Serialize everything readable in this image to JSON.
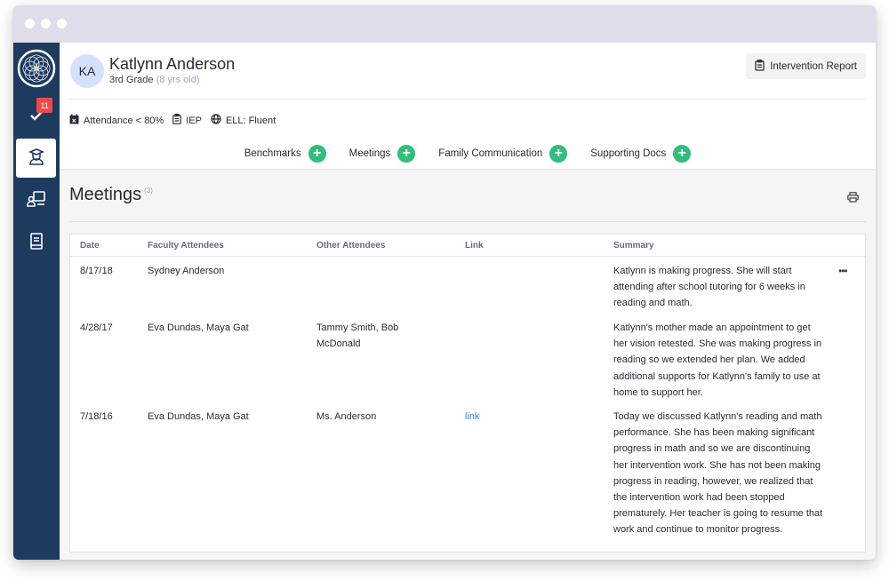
{
  "window": {
    "dots": 3
  },
  "sidebar": {
    "logo": "mandala-logo-icon",
    "items": [
      {
        "name": "tasks",
        "icon": "checkmark-icon",
        "badge": "11"
      },
      {
        "name": "students",
        "icon": "graduate-icon",
        "active": true
      },
      {
        "name": "teaching",
        "icon": "presenter-board-icon"
      },
      {
        "name": "resources",
        "icon": "book-icon"
      }
    ]
  },
  "student": {
    "initials": "KA",
    "name": "Katlynn Anderson",
    "grade": "3rd Grade",
    "age": "(8 yrs old)",
    "tags": [
      {
        "icon": "calendar-x-icon",
        "label": "Attendance < 80%"
      },
      {
        "icon": "clipboard-icon",
        "label": "IEP"
      },
      {
        "icon": "globe-icon",
        "label": "ELL: Fluent"
      }
    ]
  },
  "header": {
    "report_button": "Intervention Report"
  },
  "tabs": [
    {
      "label": "Benchmarks"
    },
    {
      "label": "Meetings"
    },
    {
      "label": "Family Communication"
    },
    {
      "label": "Supporting Docs"
    }
  ],
  "section": {
    "title": "Meetings",
    "count": "(3)"
  },
  "table": {
    "columns": [
      "Date",
      "Faculty Attendees",
      "Other Attendees",
      "Link",
      "Summary"
    ],
    "rows": [
      {
        "date": "8/17/18",
        "faculty": "Sydney Anderson",
        "other": "",
        "link": "",
        "summary": "Katlynn is making progress. She will start attending after school tutoring for 6 weeks in reading and math."
      },
      {
        "date": "4/28/17",
        "faculty": "Eva Dundas, Maya Gat",
        "other": "Tammy Smith, Bob McDonald",
        "link": "",
        "summary": "Katlynn's mother made an appointment to get her vision retested. She was making progress in reading so we extended her plan. We added additional supports for Katlynn's family to use at home to support her."
      },
      {
        "date": "7/18/16",
        "faculty": "Eva Dundas, Maya Gat",
        "other": "Ms. Anderson",
        "link": "link",
        "summary": "Today we discussed Katlynn's reading and math performance. She has been making significant progress in math and so we are discontinuing her intervention work. She has not been making progress in reading, however, we realized that the intervention work had been stopped prematurely. Her teacher is going to resume that work and continue to monitor progress."
      }
    ],
    "row_action": "more-options-icon"
  },
  "colors": {
    "sidebar": "#1d3a5f",
    "accent_green": "#2fbf7a",
    "badge_red": "#ef4a4a",
    "link_blue": "#3d7fe0",
    "titlebar": "#dedde9"
  }
}
